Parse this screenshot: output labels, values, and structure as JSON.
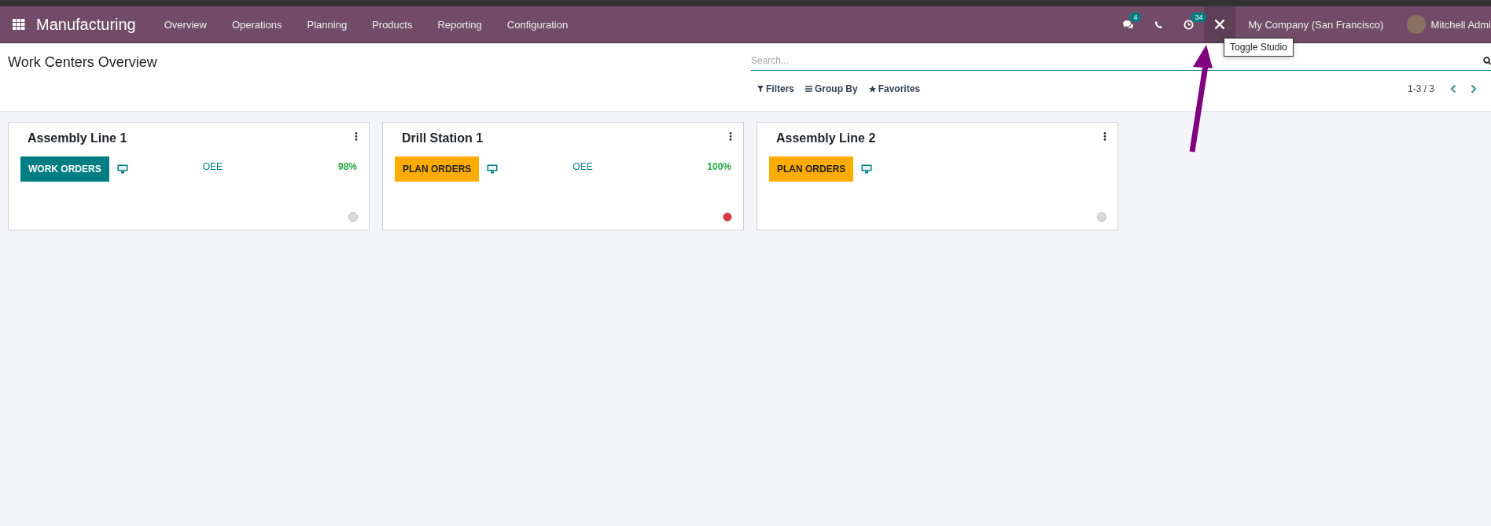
{
  "navbar": {
    "app_name": "Manufacturing",
    "menus": [
      "Overview",
      "Operations",
      "Planning",
      "Products",
      "Reporting",
      "Configuration"
    ],
    "systray": [
      {
        "kind": "chat",
        "badge": "4",
        "highlighted": false
      },
      {
        "kind": "phone",
        "highlighted": false
      },
      {
        "kind": "activity",
        "badge": "34",
        "highlighted": false
      },
      {
        "kind": "studio",
        "highlighted": true,
        "tooltip": "Toggle Studio"
      }
    ],
    "company": "My Company (San Francisco)",
    "user": "Mitchell Admi"
  },
  "control_panel": {
    "title": "Work Centers Overview",
    "search": {
      "placeholder": "Search..."
    },
    "filters": [
      {
        "kind": "filter",
        "label": "Filters"
      },
      {
        "kind": "group",
        "label": "Group By"
      },
      {
        "kind": "favorite",
        "label": "Favorites"
      }
    ],
    "pager": "1-3 / 3"
  },
  "cards": [
    {
      "name": "Assembly Line 1",
      "button": {
        "kind": "work",
        "label": "WORK ORDERS"
      },
      "oee_label": "OEE",
      "oee": "98%",
      "color": "#d8dadd"
    },
    {
      "name": "Drill Station 1",
      "button": {
        "kind": "plan",
        "label": "PLAN ORDERS"
      },
      "oee_label": "OEE",
      "oee": "100%",
      "color": "#dc3545"
    },
    {
      "name": "Assembly Line 2",
      "button": {
        "kind": "plan",
        "label": "PLAN ORDERS"
      },
      "color": "#d8dadd"
    }
  ]
}
